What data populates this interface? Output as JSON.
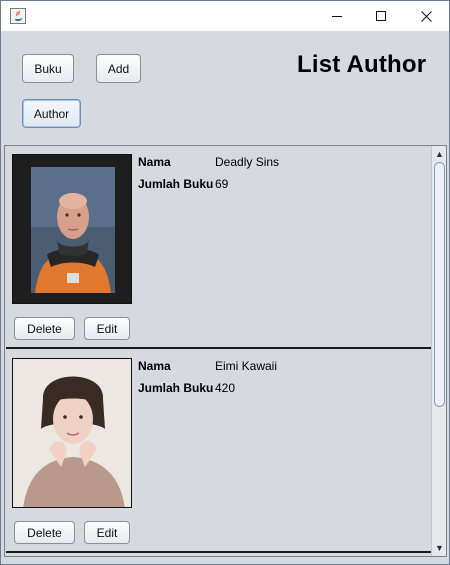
{
  "window": {
    "title": "",
    "controls": {
      "minimize": "minimize-icon",
      "maximize": "maximize-icon",
      "close": "close-icon"
    }
  },
  "nav": {
    "buku_label": "Buku",
    "add_label": "Add",
    "author_label": "Author"
  },
  "page": {
    "title": "List Author"
  },
  "authors": [
    {
      "name_label": "Nama",
      "name": "Deadly Sins",
      "count_label": "Jumlah Buku",
      "count": "69",
      "delete_label": "Delete",
      "edit_label": "Edit"
    },
    {
      "name_label": "Nama",
      "name": "Eimi Kawaii",
      "count_label": "Jumlah Buku",
      "count": "420",
      "delete_label": "Delete",
      "edit_label": "Edit"
    }
  ],
  "colors": {
    "background": "#d6d9df",
    "selected_border": "#6e8fbb",
    "divider": "#1b1b1b"
  }
}
